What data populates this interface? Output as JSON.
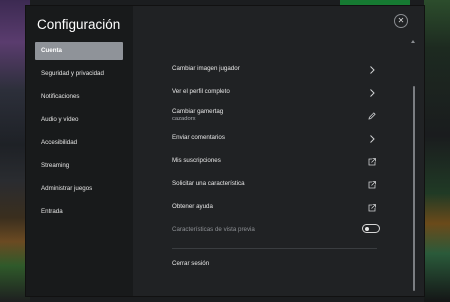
{
  "window": {
    "title": "Configuración",
    "close_label": "✕"
  },
  "sidebar": {
    "items": [
      {
        "label": "Cuenta",
        "active": true
      },
      {
        "label": "Seguridad y privacidad",
        "active": false
      },
      {
        "label": "Notificaciones",
        "active": false
      },
      {
        "label": "Audio y vídeo",
        "active": false
      },
      {
        "label": "Accesibilidad",
        "active": false
      },
      {
        "label": "Streaming",
        "active": false
      },
      {
        "label": "Administrar juegos",
        "active": false
      },
      {
        "label": "Entrada",
        "active": false
      }
    ]
  },
  "settings": {
    "change_picture": {
      "label": "Cambiar imagen jugador",
      "icon": "chevron-right-icon"
    },
    "view_profile": {
      "label": "Ver el perfil completo",
      "icon": "chevron-right-icon"
    },
    "change_gamertag": {
      "label": "Cambiar gamertag",
      "value": "cazadorx",
      "icon": "pencil-icon"
    },
    "send_feedback": {
      "label": "Enviar comentarios",
      "icon": "chevron-right-icon"
    },
    "subscriptions": {
      "label": "Mis suscripciones",
      "icon": "external-link-icon"
    },
    "request_feature": {
      "label": "Solicitar una característica",
      "icon": "external-link-icon"
    },
    "get_help": {
      "label": "Obtener ayuda",
      "icon": "external-link-icon"
    },
    "preview_features": {
      "label": "Características de vista previa",
      "toggle_on": false
    },
    "sign_out": {
      "label": "Cerrar sesión"
    }
  },
  "colors": {
    "modal_bg": "#202224",
    "sidebar_bg": "#181a1b",
    "active_item_bg": "#8f9399",
    "text": "#e8e8e8",
    "muted_text": "#8d9094"
  }
}
